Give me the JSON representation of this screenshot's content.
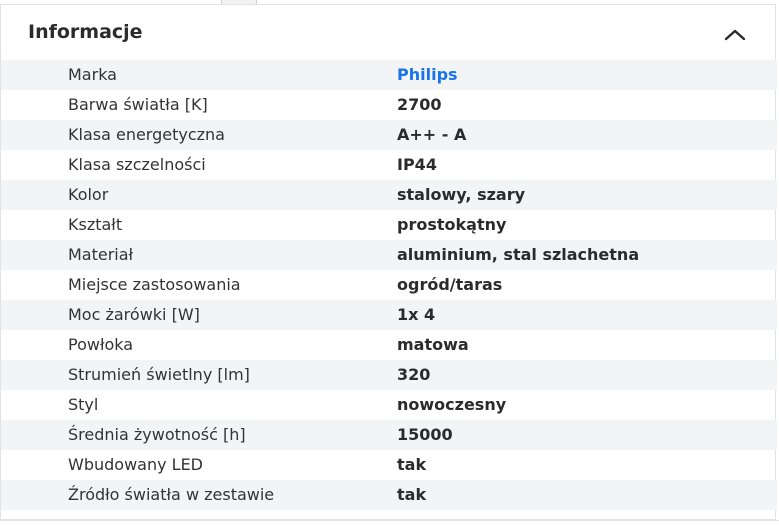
{
  "header": {
    "title": "Informacje",
    "collapse_icon": "chevron-up-icon"
  },
  "specs": [
    {
      "label": "Marka",
      "value": "Philips",
      "link": true
    },
    {
      "label": "Barwa światła [K]",
      "value": "2700"
    },
    {
      "label": "Klasa energetyczna",
      "value": "A++ - A"
    },
    {
      "label": "Klasa szczelności",
      "value": "IP44"
    },
    {
      "label": "Kolor",
      "value": "stalowy, szary"
    },
    {
      "label": "Kształt",
      "value": "prostokątny"
    },
    {
      "label": "Materiał",
      "value": "aluminium, stal szlachetna"
    },
    {
      "label": "Miejsce zastosowania",
      "value": "ogród/taras"
    },
    {
      "label": "Moc żarówki [W]",
      "value": "1x 4"
    },
    {
      "label": "Powłoka",
      "value": "matowa"
    },
    {
      "label": "Strumień świetlny [lm]",
      "value": "320"
    },
    {
      "label": "Styl",
      "value": "nowoczesny"
    },
    {
      "label": "Średnia żywotność [h]",
      "value": "15000"
    },
    {
      "label": "Wbudowany LED",
      "value": "tak"
    },
    {
      "label": "Źródło światła w zestawie",
      "value": "tak"
    }
  ],
  "colors": {
    "link": "#1a73e8",
    "row_alt": "#f3f4f6"
  }
}
